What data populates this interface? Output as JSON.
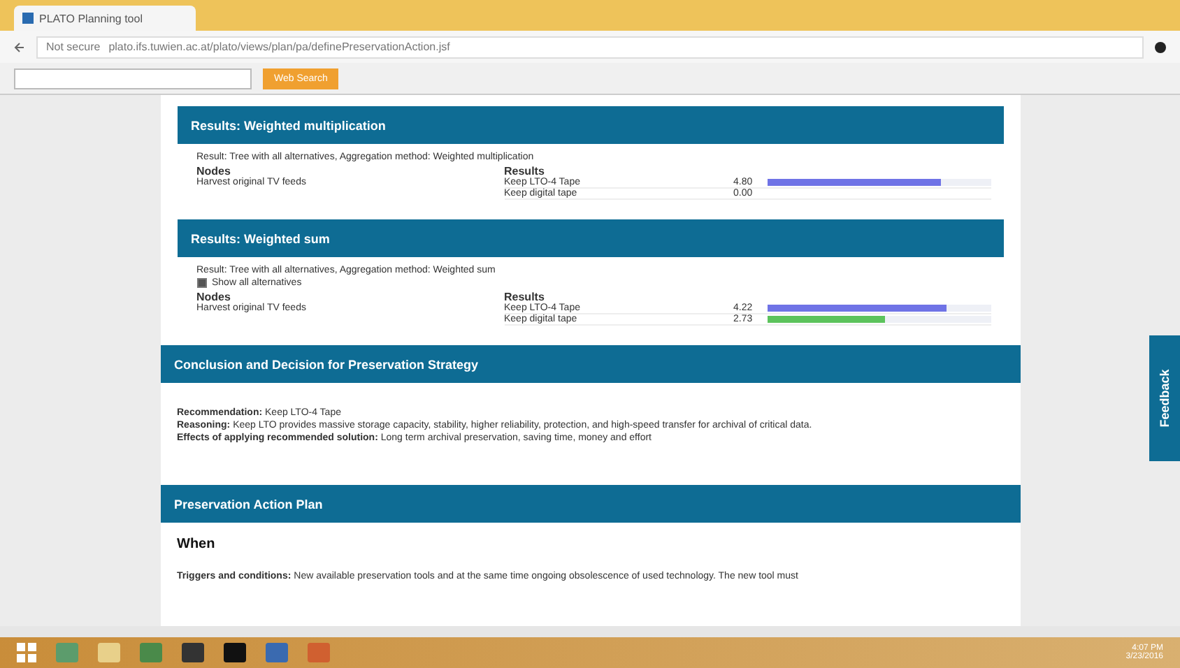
{
  "browser": {
    "tab_title": "PLATO Planning tool",
    "url_secure": "Not secure",
    "url": "plato.ifs.tuwien.ac.at/plato/views/plan/pa/definePreservationAction.jsf",
    "toolbar_button": "Web Search"
  },
  "sections": [
    {
      "kind": "results",
      "title": "Results: Weighted multiplication",
      "caption": "Result: Tree with all alternatives, Aggregation method: Weighted multiplication",
      "nodes_label": "Nodes",
      "results_label": "Results",
      "node": "Harvest original TV feeds",
      "rows": [
        {
          "name": "Keep LTO-4 Tape",
          "value": "4.80",
          "level": 0.78,
          "color": "#6f73e6"
        },
        {
          "name": "Keep digital tape",
          "value": "0.00"
        }
      ]
    },
    {
      "kind": "results",
      "title": "Results: Weighted sum",
      "caption": "Result: Tree with all alternatives, Aggregation method: Weighted sum",
      "show_all": {
        "label": "Show all alternatives",
        "checked": true
      },
      "nodes_label": "Nodes",
      "results_label": "Results",
      "node": "Harvest original TV feeds",
      "rows": [
        {
          "name": "Keep LTO-4 Tape",
          "value": "4.22",
          "level": 0.8,
          "color": "#6f73e6"
        },
        {
          "name": "Keep digital tape",
          "value": "2.73",
          "level": 0.53,
          "color": "#5cc35c"
        }
      ]
    },
    {
      "kind": "conclusion",
      "title": "Conclusion and Decision for Preservation Strategy",
      "lines": [
        "**Recommendation:** Keep LTO-4 Tape",
        "**Reasoning:** Keep LTO provides massive storage capacity, stability, higher reliability, protection, and high-speed transfer for archival of critical data.",
        "**Effects of applying recommended solution:** Long term archival preservation, saving time, money and effort"
      ]
    },
    {
      "kind": "plan",
      "title": "Preservation Action Plan",
      "heading": "When",
      "text": "**Triggers and conditions:** New available preservation tools and at the same time ongoing obsolescence of used technology. The new tool must"
    }
  ],
  "feedback": "Feedback",
  "clock": {
    "time": "4:07 PM",
    "date": "3/23/2016"
  }
}
